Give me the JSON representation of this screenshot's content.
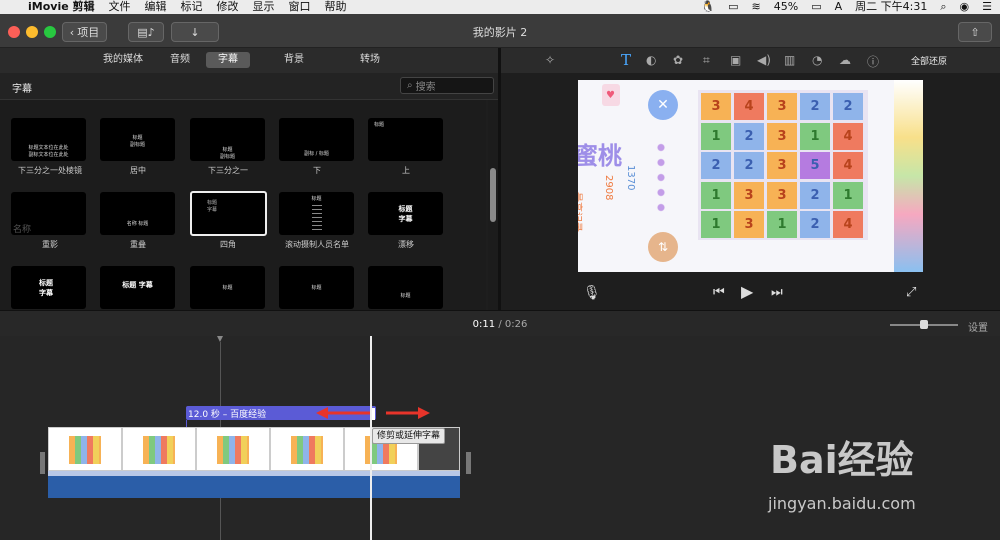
{
  "menubar": {
    "app": "iMovie 剪辑",
    "items": [
      "文件",
      "编辑",
      "标记",
      "修改",
      "显示",
      "窗口",
      "帮助"
    ],
    "battery": "45%",
    "datetime": "周二 下午4:31"
  },
  "titlebar": {
    "back_label": "项目",
    "title": "我的影片 2"
  },
  "library": {
    "tabs": [
      "我的媒体",
      "音频",
      "字幕",
      "背景",
      "转场"
    ],
    "selected_tab": "字幕",
    "title": "字幕",
    "search_placeholder": "搜索",
    "titles": [
      {
        "label": "下三分之一处棱镜",
        "preview": "标题文本位在此处\n副标文本位在此处"
      },
      {
        "label": "居中",
        "preview": "标题\n副标题"
      },
      {
        "label": "下三分之一",
        "preview": "标题\n副标题"
      },
      {
        "label": "下",
        "preview": "副标 / 标题"
      },
      {
        "label": "上",
        "preview": "标题"
      },
      {
        "label": "重影",
        "preview": "名称"
      },
      {
        "label": "重叠",
        "preview": "名称 标题"
      },
      {
        "label": "四角",
        "preview": "标题\n字幕"
      },
      {
        "label": "滚动摄制人员名单",
        "preview": "标题"
      },
      {
        "label": "漂移",
        "preview": "标题\n字幕"
      },
      {
        "label": "",
        "preview": "标题\n字幕"
      },
      {
        "label": "",
        "preview": "标题 字幕"
      },
      {
        "label": "",
        "preview": "标题"
      },
      {
        "label": "",
        "preview": "标题"
      },
      {
        "label": "",
        "preview": "标题"
      }
    ]
  },
  "inspector": {
    "reset_all": "全部还原",
    "tools": [
      "magic-wand",
      "text",
      "color-balance",
      "color-correction",
      "crop",
      "stabilization",
      "volume",
      "noise-reduction",
      "speed",
      "video-filter",
      "info"
    ]
  },
  "video": {
    "title_text": "蜜桃",
    "best_label": "最高记录",
    "best_value": "2908",
    "score": "1370",
    "grid": [
      [
        [
          "3",
          "#f7b255"
        ],
        [
          "4",
          "#ef7a5f"
        ],
        [
          "3",
          "#f7b255"
        ],
        [
          "2",
          "#8fb4ea"
        ],
        [
          "2",
          "#8fb4ea"
        ]
      ],
      [
        [
          "1",
          "#7fc97f"
        ],
        [
          "2",
          "#8fb4ea"
        ],
        [
          "3",
          "#f7b255"
        ],
        [
          "1",
          "#7fc97f"
        ],
        [
          "4",
          "#ef7a5f"
        ]
      ],
      [
        [
          "2",
          "#8fb4ea"
        ],
        [
          "2",
          "#8fb4ea"
        ],
        [
          "3",
          "#f7b255"
        ],
        [
          "5",
          "#b57be0"
        ],
        [
          "4",
          "#ef7a5f"
        ]
      ],
      [
        [
          "1",
          "#7fc97f"
        ],
        [
          "3",
          "#f7b255"
        ],
        [
          "3",
          "#f7b255"
        ],
        [
          "2",
          "#8fb4ea"
        ],
        [
          "1",
          "#7fc97f"
        ]
      ],
      [
        [
          "1",
          "#7fc97f"
        ],
        [
          "3",
          "#f7b255"
        ],
        [
          "1",
          "#7fc97f"
        ],
        [
          "2",
          "#8fb4ea"
        ],
        [
          "4",
          "#ef7a5f"
        ]
      ]
    ]
  },
  "timeline": {
    "current_time": "0:11",
    "separator": "/",
    "total_time": "0:26",
    "settings_label": "设置",
    "title_clip_label": "12.0 秒 – 百度经验",
    "tooltip": "修剪或延伸字幕",
    "zoom_level": 0.5
  },
  "watermark": {
    "brand": "Bai经验",
    "url": "jingyan.baidu.com"
  },
  "colors": {
    "accent": "#5b5bd6",
    "arrow": "#e8342a",
    "audio_track": "#2b5ea8"
  }
}
